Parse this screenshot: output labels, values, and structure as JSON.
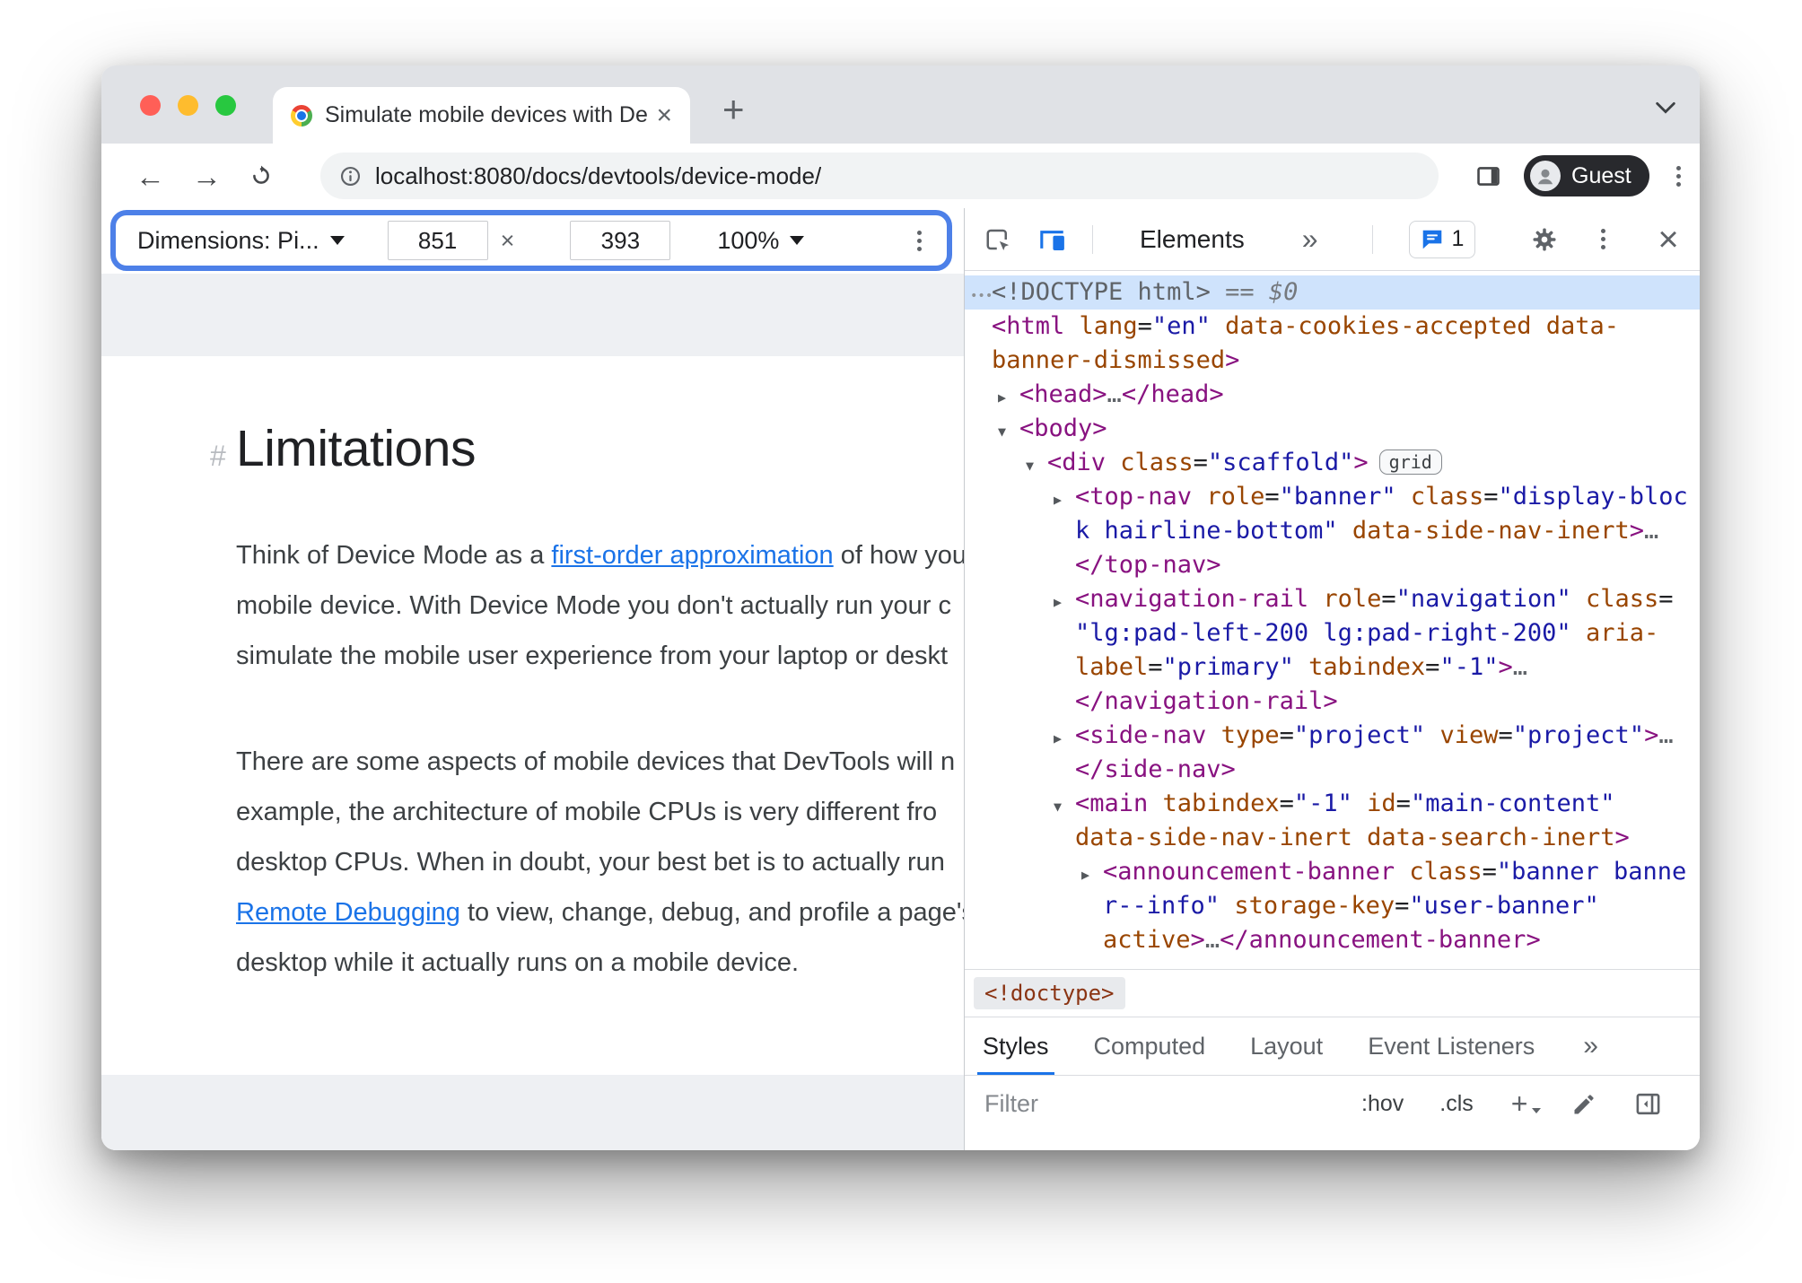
{
  "colors": {
    "highlight_ring": "#4d80e8",
    "active_icon_blue": "#1a73e8",
    "link_blue": "#1a73e8",
    "tag_purple": "#881280",
    "attribute_brown": "#994500",
    "value_blue": "#1a1aa6",
    "selection_bg": "#cfe3fc"
  },
  "icons": {
    "back": "←",
    "forward": "→",
    "expand": "▶",
    "collapse": "▼",
    "overflow_dots": "•••"
  },
  "window": {
    "tab_title": "Simulate mobile devices with Device Mode",
    "close_tab_glyph": "×",
    "new_tab_glyph": "+",
    "url": "localhost:8080/docs/devtools/device-mode/",
    "guest_label": "Guest"
  },
  "device_toolbar": {
    "dimensions_label": "Dimensions: Pi...",
    "width_value": "851",
    "separator": "×",
    "height_value": "393",
    "zoom_value": "100%"
  },
  "page": {
    "heading_hash": "#",
    "heading": "Limitations",
    "paragraphs": [
      {
        "lines": [
          [
            [
              "x",
              "Think of Device Mode as a "
            ],
            [
              "l",
              "first-order approximation"
            ],
            [
              "x",
              " of how your"
            ]
          ],
          [
            [
              "x",
              "mobile device. With Device Mode you don't actually run your c"
            ]
          ],
          [
            [
              "x",
              "simulate the mobile user experience from your laptop or deskt"
            ]
          ]
        ]
      },
      {
        "lines": [
          [
            [
              "x",
              "There are some aspects of mobile devices that DevTools will n"
            ]
          ],
          [
            [
              "x",
              "example, the architecture of mobile CPUs is very different fro"
            ]
          ],
          [
            [
              "x",
              "desktop CPUs. When in doubt, your best bet is to actually run"
            ]
          ],
          [
            [
              "l",
              "Remote Debugging"
            ],
            [
              "x",
              " to view, change, debug, and profile a page's"
            ]
          ],
          [
            [
              "x",
              "desktop while it actually runs on a mobile device."
            ]
          ]
        ]
      }
    ]
  },
  "devtools": {
    "panel_tabs": {
      "elements_label": "Elements",
      "more_label": "»"
    },
    "issues_count": "1",
    "breadcrumb": "<!doctype>",
    "styles_tabs": [
      "Styles",
      "Computed",
      "Layout",
      "Event Listeners"
    ],
    "styles_more_label": "»",
    "filter_placeholder": "Filter",
    "state_toggles": [
      ":hov",
      ".cls",
      "+"
    ],
    "tree": [
      {
        "sel": true,
        "dots": true,
        "indent": 0,
        "segs": [
          [
            "g",
            "<!DOCTYPE html>"
          ],
          [
            "i",
            " == $0"
          ]
        ]
      },
      {
        "indent": 0,
        "segs": [
          [
            "t",
            "<html"
          ],
          [
            "k",
            " "
          ],
          [
            "a",
            "lang"
          ],
          [
            "k",
            "="
          ],
          [
            "v",
            "\"en\""
          ],
          [
            "k",
            " "
          ],
          [
            "a",
            "data-cookies-accepted"
          ],
          [
            "k",
            " "
          ],
          [
            "a",
            "data-"
          ]
        ]
      },
      {
        "indent": 0,
        "segs": [
          [
            "a",
            "banner-dismissed"
          ],
          [
            "t",
            ">"
          ]
        ]
      },
      {
        "indent": 1,
        "arrow": "r",
        "segs": [
          [
            "t",
            "<head>"
          ],
          [
            "g",
            "…"
          ],
          [
            "t",
            "</head>"
          ]
        ]
      },
      {
        "indent": 1,
        "arrow": "d",
        "segs": [
          [
            "t",
            "<body>"
          ]
        ]
      },
      {
        "indent": 2,
        "arrow": "d",
        "segs": [
          [
            "t",
            "<div"
          ],
          [
            "k",
            " "
          ],
          [
            "a",
            "class"
          ],
          [
            "k",
            "="
          ],
          [
            "v",
            "\"scaffold\""
          ],
          [
            "t",
            ">"
          ]
        ],
        "badge": "grid"
      },
      {
        "indent": 3,
        "arrow": "r",
        "segs": [
          [
            "t",
            "<top-nav"
          ],
          [
            "k",
            " "
          ],
          [
            "a",
            "role"
          ],
          [
            "k",
            "="
          ],
          [
            "v",
            "\"banner\""
          ],
          [
            "k",
            " "
          ],
          [
            "a",
            "class"
          ],
          [
            "k",
            "="
          ],
          [
            "v",
            "\"display-bloc"
          ]
        ]
      },
      {
        "indent": 3,
        "segs": [
          [
            "v",
            "k hairline-bottom\""
          ],
          [
            "k",
            " "
          ],
          [
            "a",
            "data-side-nav-inert"
          ],
          [
            "t",
            ">"
          ],
          [
            "g",
            "…"
          ]
        ]
      },
      {
        "indent": 3,
        "segs": [
          [
            "t",
            "</top-nav>"
          ]
        ]
      },
      {
        "indent": 3,
        "arrow": "r",
        "segs": [
          [
            "t",
            "<navigation-rail"
          ],
          [
            "k",
            " "
          ],
          [
            "a",
            "role"
          ],
          [
            "k",
            "="
          ],
          [
            "v",
            "\"navigation\""
          ],
          [
            "k",
            " "
          ],
          [
            "a",
            "class"
          ],
          [
            "k",
            "="
          ]
        ]
      },
      {
        "indent": 3,
        "segs": [
          [
            "v",
            "\"lg:pad-left-200 lg:pad-right-200\""
          ],
          [
            "k",
            " "
          ],
          [
            "a",
            "aria-"
          ]
        ]
      },
      {
        "indent": 3,
        "segs": [
          [
            "a",
            "label"
          ],
          [
            "k",
            "="
          ],
          [
            "v",
            "\"primary\""
          ],
          [
            "k",
            " "
          ],
          [
            "a",
            "tabindex"
          ],
          [
            "k",
            "="
          ],
          [
            "v",
            "\"-1\""
          ],
          [
            "t",
            ">"
          ],
          [
            "g",
            "…"
          ]
        ]
      },
      {
        "indent": 3,
        "segs": [
          [
            "t",
            "</navigation-rail>"
          ]
        ]
      },
      {
        "indent": 3,
        "arrow": "r",
        "segs": [
          [
            "t",
            "<side-nav"
          ],
          [
            "k",
            " "
          ],
          [
            "a",
            "type"
          ],
          [
            "k",
            "="
          ],
          [
            "v",
            "\"project\""
          ],
          [
            "k",
            " "
          ],
          [
            "a",
            "view"
          ],
          [
            "k",
            "="
          ],
          [
            "v",
            "\"project\""
          ],
          [
            "t",
            ">"
          ],
          [
            "g",
            "…"
          ]
        ]
      },
      {
        "indent": 3,
        "segs": [
          [
            "t",
            "</side-nav>"
          ]
        ]
      },
      {
        "indent": 3,
        "arrow": "d",
        "segs": [
          [
            "t",
            "<main"
          ],
          [
            "k",
            " "
          ],
          [
            "a",
            "tabindex"
          ],
          [
            "k",
            "="
          ],
          [
            "v",
            "\"-1\""
          ],
          [
            "k",
            " "
          ],
          [
            "a",
            "id"
          ],
          [
            "k",
            "="
          ],
          [
            "v",
            "\"main-content\""
          ]
        ]
      },
      {
        "indent": 3,
        "segs": [
          [
            "a",
            "data-side-nav-inert"
          ],
          [
            "k",
            " "
          ],
          [
            "a",
            "data-search-inert"
          ],
          [
            "t",
            ">"
          ]
        ]
      },
      {
        "indent": 4,
        "arrow": "r",
        "segs": [
          [
            "t",
            "<announcement-banner"
          ],
          [
            "k",
            " "
          ],
          [
            "a",
            "class"
          ],
          [
            "k",
            "="
          ],
          [
            "v",
            "\"banner banne"
          ]
        ]
      },
      {
        "indent": 4,
        "segs": [
          [
            "v",
            "r--info\""
          ],
          [
            "k",
            " "
          ],
          [
            "a",
            "storage-key"
          ],
          [
            "k",
            "="
          ],
          [
            "v",
            "\"user-banner\""
          ]
        ]
      },
      {
        "indent": 4,
        "segs": [
          [
            "a",
            "active"
          ],
          [
            "t",
            ">"
          ],
          [
            "g",
            "…"
          ],
          [
            "t",
            "</announcement-banner>"
          ]
        ]
      }
    ]
  }
}
